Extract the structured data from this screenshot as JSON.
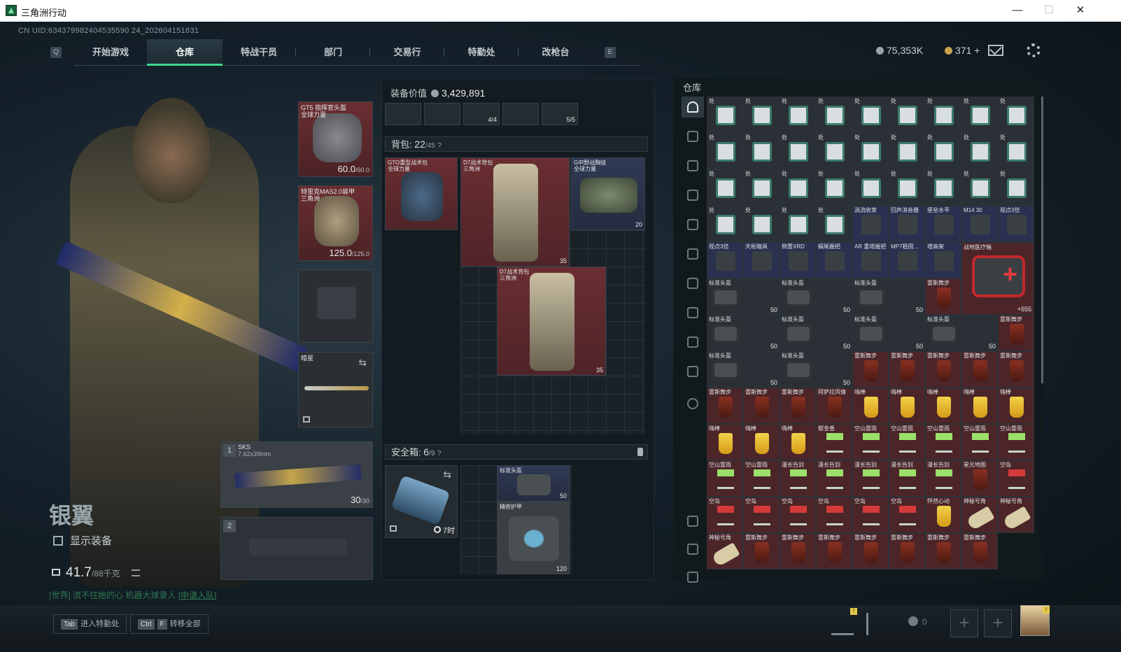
{
  "window": {
    "title": "三角洲行动",
    "minimize": "—",
    "maximize": "☐",
    "close": "✕"
  },
  "uid": "CN UID:634379982404535590 24_202604151831",
  "nav": {
    "left_key": "Q",
    "right_key": "E",
    "tabs": [
      "开始游戏",
      "仓库",
      "特战干员",
      "部门",
      "交易行",
      "特勤处",
      "改枪台"
    ],
    "active": "仓库"
  },
  "currency": {
    "silver": "75,353K",
    "gold": "371",
    "gold_add": "+"
  },
  "character": {
    "name": "银翼",
    "show_equipment": "显示装备",
    "weight": "41.7",
    "weight_max": "/88千克"
  },
  "chat": {
    "text": "[世界] 流不住她的心  机器大球录人",
    "link": "[申请入队]"
  },
  "gear": {
    "helmet": {
      "label": "GT5 指挥官头盔\n全球力量",
      "durability": "60.0",
      "max": "/60.0"
    },
    "armor": {
      "label": "特里克MAS2.0装甲\n三角洲",
      "durability": "125.0",
      "max": "/125.0"
    },
    "melee": {
      "label": "暗星"
    },
    "weapon1": {
      "slot": "1",
      "name": "SKS",
      "caliber": "7.62x39mm",
      "ammo": "30",
      "ammo_max": "/30"
    },
    "weapon2": {
      "slot": "2"
    }
  },
  "equipment_value": {
    "label": "装备价值",
    "value": "3,429,891"
  },
  "mag_slots": [
    {
      "val": "4/4"
    },
    {
      "val": "5/5"
    }
  ],
  "backpack": {
    "label": "背包:",
    "count": "22",
    "max": "/45",
    "help": "?",
    "items": [
      {
        "label": "GTO重型战术包\n全球力量"
      },
      {
        "label": "D7战术背包\n三角洲",
        "val": "35"
      },
      {
        "label": "GIR野战胸挂\n全球力量",
        "val": "20"
      },
      {
        "label": "D7战术背包\n三角洲",
        "val": "35"
      }
    ]
  },
  "safebox": {
    "label": "安全箱:",
    "count": "6",
    "max": "/9",
    "help": "?",
    "timer": "7时",
    "items": [
      {
        "label": "标准头盔",
        "val": "50"
      },
      {
        "label": "精密护甲",
        "val": "120"
      }
    ]
  },
  "warehouse": {
    "title": "仓库",
    "phone_label": "处",
    "rows": [
      [
        {
          "t": "phone"
        },
        {
          "t": "phone"
        },
        {
          "t": "phone"
        },
        {
          "t": "phone"
        },
        {
          "t": "phone"
        },
        {
          "t": "phone"
        },
        {
          "t": "phone"
        },
        {
          "t": "phone"
        },
        {
          "t": "phone"
        }
      ],
      [
        {
          "t": "phone"
        },
        {
          "t": "phone"
        },
        {
          "t": "phone"
        },
        {
          "t": "phone"
        },
        {
          "t": "phone"
        },
        {
          "t": "phone"
        },
        {
          "t": "phone"
        },
        {
          "t": "phone"
        },
        {
          "t": "phone"
        }
      ],
      [
        {
          "t": "phone"
        },
        {
          "t": "phone"
        },
        {
          "t": "phone"
        },
        {
          "t": "phone"
        },
        {
          "t": "phone"
        },
        {
          "t": "phone"
        },
        {
          "t": "phone"
        },
        {
          "t": "phone"
        },
        {
          "t": "phone"
        }
      ],
      [
        {
          "t": "phone"
        },
        {
          "t": "phone"
        },
        {
          "t": "phone"
        },
        {
          "t": "phone"
        },
        {
          "t": "part",
          "l": "涡流收束"
        },
        {
          "t": "part",
          "l": "回声消音器"
        },
        {
          "t": "part",
          "l": "堡垒水平"
        },
        {
          "t": "part",
          "l": "M14 30"
        },
        {
          "t": "part",
          "l": "视点3倍"
        }
      ],
      [
        {
          "t": "part",
          "l": "视点3倍"
        },
        {
          "t": "part",
          "l": "天枢瞄具"
        },
        {
          "t": "part",
          "l": "倒置XRD"
        },
        {
          "t": "part",
          "l": "蝎尾握把"
        },
        {
          "t": "part",
          "l": "AR 重塔握把"
        },
        {
          "t": "part",
          "l": "MP7稳固…"
        },
        {
          "t": "part",
          "l": "增高架"
        }
      ]
    ],
    "medkit": {
      "label": "战地医疗箱",
      "val": "555"
    },
    "bags": [
      {
        "l": "标准头盔",
        "v": "50"
      },
      {
        "l": "标准头盔",
        "v": "50"
      },
      {
        "l": "标准头盔",
        "v": "50"
      },
      {
        "l": "标准头盔",
        "v": "50"
      },
      {
        "l": "标准头盔",
        "v": "50"
      },
      {
        "l": "标准头盔",
        "v": "50"
      },
      {
        "l": "标准头盔",
        "v": "50"
      },
      {
        "l": "标准头盔",
        "v": "50"
      },
      {
        "l": "标准头盔",
        "v": "50"
      }
    ],
    "drinks": [
      {
        "t": "drink",
        "l": "雷斯舞步"
      },
      {
        "t": "drink",
        "l": "雷斯舞步"
      },
      {
        "t": "drink",
        "l": "雷斯舞步"
      },
      {
        "t": "drink",
        "l": "雷斯舞步"
      },
      {
        "t": "drink",
        "l": "雷斯舞步"
      },
      {
        "t": "drink",
        "l": "雷斯舞步"
      },
      {
        "t": "drink",
        "l": "雷斯舞步"
      },
      {
        "t": "drink",
        "l": "雷斯舞步"
      },
      {
        "t": "drink",
        "l": "雷斯舞步"
      },
      {
        "t": "drink",
        "l": "雷斯舞步"
      },
      {
        "t": "drink",
        "l": "阿萨拉风情"
      },
      {
        "t": "lemon",
        "l": "嗨棒"
      },
      {
        "t": "lemon",
        "l": "嗨棒"
      },
      {
        "t": "lemon",
        "l": "嗨棒"
      },
      {
        "t": "lemon",
        "l": "嗨棒"
      },
      {
        "t": "lemon",
        "l": "嗨棒"
      },
      {
        "t": "lemon",
        "l": "嗨棒"
      },
      {
        "t": "lemon",
        "l": "嗨棒"
      },
      {
        "t": "lemon",
        "l": "嗨棒"
      },
      {
        "t": "green",
        "l": "郁金香"
      },
      {
        "t": "green",
        "l": "空山雷雨"
      },
      {
        "t": "green",
        "l": "空山雷雨"
      },
      {
        "t": "green",
        "l": "空山雷雨"
      },
      {
        "t": "green",
        "l": "空山雷雨"
      },
      {
        "t": "green",
        "l": "空山雷雨"
      },
      {
        "t": "green",
        "l": "空山雷雨"
      },
      {
        "t": "green",
        "l": "空山雷雨"
      },
      {
        "t": "green",
        "l": "漫长告别"
      },
      {
        "t": "green",
        "l": "漫长告别"
      },
      {
        "t": "green",
        "l": "漫长告别"
      },
      {
        "t": "green",
        "l": "漫长告别"
      },
      {
        "t": "green",
        "l": "漫长告别"
      },
      {
        "t": "drink",
        "l": "星光地图"
      },
      {
        "t": "cocktail",
        "l": "空岛"
      },
      {
        "t": "cocktail",
        "l": "空岛"
      },
      {
        "t": "cocktail",
        "l": "空岛"
      },
      {
        "t": "cocktail",
        "l": "空岛"
      },
      {
        "t": "cocktail",
        "l": "空岛"
      },
      {
        "t": "cocktail",
        "l": "空岛"
      },
      {
        "t": "cocktail",
        "l": "空岛"
      },
      {
        "t": "lemon",
        "l": "怦然心动"
      },
      {
        "t": "horn",
        "l": "神秘号角"
      },
      {
        "t": "horn",
        "l": "神秘号角"
      },
      {
        "t": "horn",
        "l": "神秘号角"
      },
      {
        "t": "drink",
        "l": "雷斯舞步"
      },
      {
        "t": "drink",
        "l": "雷斯舞步"
      },
      {
        "t": "drink",
        "l": "雷斯舞步"
      },
      {
        "t": "drink",
        "l": "雷斯舞步"
      },
      {
        "t": "drink",
        "l": "雷斯舞步"
      },
      {
        "t": "drink",
        "l": "雷斯舞步"
      },
      {
        "t": "drink",
        "l": "雷斯舞步"
      }
    ]
  },
  "bottom": {
    "enter_key": "Tab",
    "enter_label": "进入特勤处",
    "transfer_keys": [
      "Ctrl",
      "F"
    ],
    "transfer_label": "转移全部",
    "friends_count": "0",
    "plus": "+"
  }
}
